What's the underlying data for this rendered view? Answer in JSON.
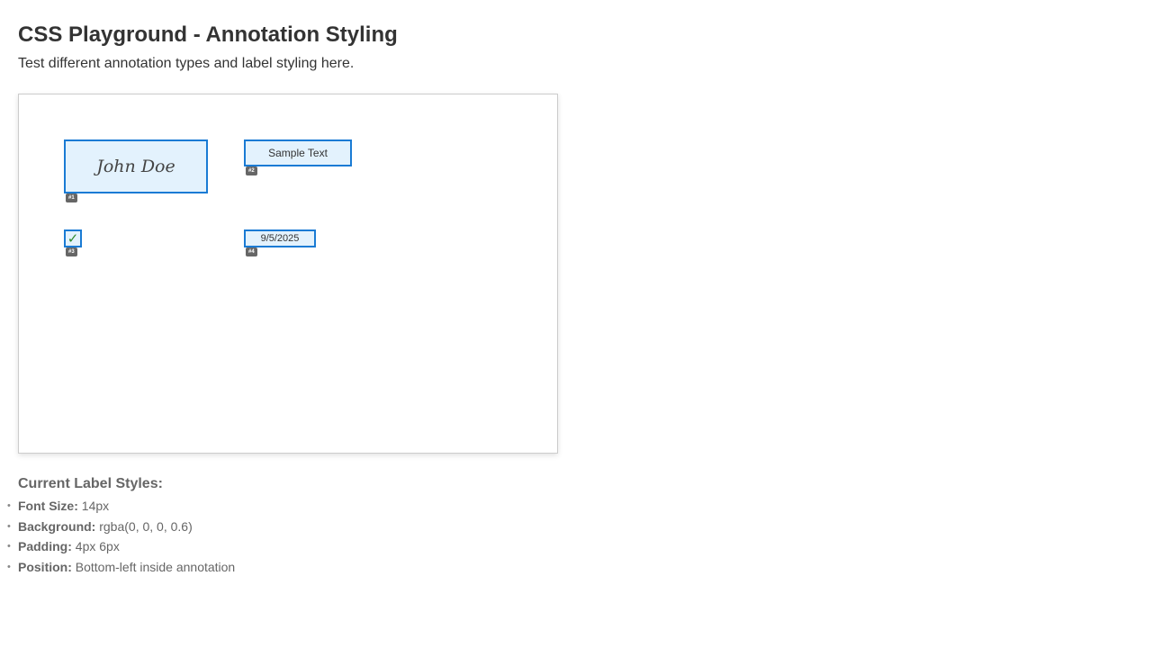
{
  "header": {
    "title": "CSS Playground - Annotation Styling",
    "subtitle": "Test different annotation types and label styling here."
  },
  "annotations": [
    {
      "type": "signature",
      "value": "John Doe",
      "label": "#1"
    },
    {
      "type": "text",
      "value": "Sample Text",
      "label": "#2"
    },
    {
      "type": "checkbox",
      "value": "✓",
      "label": "#3"
    },
    {
      "type": "date",
      "value": "9/5/2025",
      "label": "#4"
    }
  ],
  "label_styles": {
    "heading": "Current Label Styles:",
    "items": [
      {
        "key": "Font Size:",
        "value": "14px"
      },
      {
        "key": "Background:",
        "value": "rgba(0, 0, 0, 0.6)"
      },
      {
        "key": "Padding:",
        "value": "4px 6px"
      },
      {
        "key": "Position:",
        "value": "Bottom-left inside annotation"
      }
    ]
  },
  "colors": {
    "annotation_border": "#1a7bd4",
    "annotation_fill": "#e3f2fd",
    "check": "#2e8b2e"
  }
}
